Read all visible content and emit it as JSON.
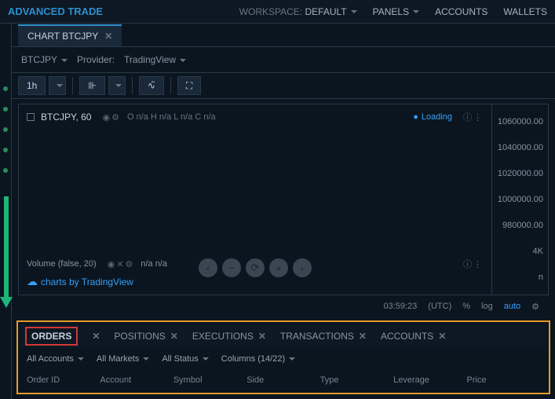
{
  "topbar": {
    "brand": "ADVANCED TRADE",
    "workspace_label": "WORKSPACE:",
    "workspace_value": "DEFAULT",
    "panels": "PANELS",
    "accounts": "ACCOUNTS",
    "wallets": "WALLETS"
  },
  "chart_tab": "CHART BTCJPY",
  "symbol": "BTCJPY",
  "provider_label": "Provider:",
  "provider": "TradingView",
  "timeframe": "1h",
  "chart": {
    "ticker": "BTCJPY, 60",
    "ohlc": "O n/a H n/a L n/a C n/a",
    "loading": "Loading",
    "volume": "Volume (false, 20)",
    "vol_vals": "n/a n/a",
    "credits": "charts by TradingView"
  },
  "yaxis": [
    "1060000.00",
    "1040000.00",
    "1020000.00",
    "1000000.00",
    "980000.00",
    "4K",
    "n"
  ],
  "footer": {
    "time": "03:59:23",
    "tz": "(UTC)",
    "pct": "%",
    "log": "log",
    "auto": "auto"
  },
  "orders": {
    "tabs": [
      "ORDERS",
      "POSITIONS",
      "EXECUTIONS",
      "TRANSACTIONS",
      "ACCOUNTS"
    ],
    "filters": [
      "All Accounts",
      "All Markets",
      "All Status",
      "Columns (14/22)"
    ],
    "columns": [
      "Order ID",
      "Account",
      "Symbol",
      "Side",
      "Type",
      "Leverage",
      "Price"
    ]
  }
}
